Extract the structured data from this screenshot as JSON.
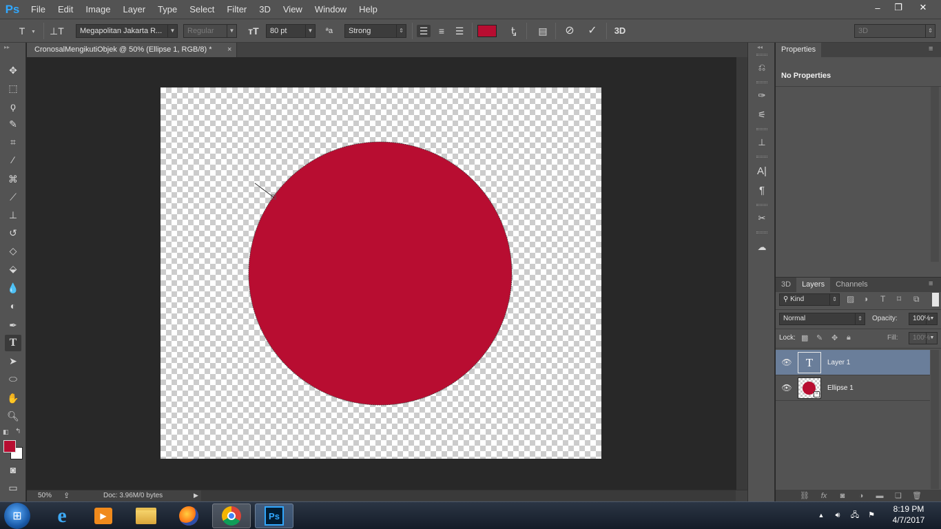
{
  "app": {
    "logo": "Ps"
  },
  "menu": [
    "File",
    "Edit",
    "Image",
    "Layer",
    "Type",
    "Select",
    "Filter",
    "3D",
    "View",
    "Window",
    "Help"
  ],
  "window_controls": {
    "minimize": "‒",
    "restore": "❐",
    "close": "✕"
  },
  "options": {
    "font_family": "Megapolitan Jakarta R...",
    "font_style": "Regular",
    "font_size": "80 pt",
    "aa_label": "ªa",
    "anti_alias": "Strong",
    "text_color": "#b80d31",
    "workspace": "3D"
  },
  "document": {
    "tab_title": "CronosalMengikutiObjek @ 50% (Ellipse 1, RGB/8) *",
    "close": "×",
    "zoom": "50%",
    "doc_info": "Doc: 3.96M/0 bytes",
    "ellipse_color": "#b80d31"
  },
  "tools": {
    "foreground_color": "#b80d31",
    "background_color": "#ffffff"
  },
  "properties": {
    "tab": "Properties",
    "body": "No Properties"
  },
  "layers": {
    "tabs": [
      "3D",
      "Layers",
      "Channels"
    ],
    "filter_kind": "Kind",
    "blend_mode": "Normal",
    "opacity_label": "Opacity:",
    "opacity": "100%",
    "lock_label": "Lock:",
    "fill_label": "Fill:",
    "fill": "100%",
    "items": [
      {
        "name": "Layer 1",
        "type": "text",
        "selected": true
      },
      {
        "name": "Ellipse 1",
        "type": "shape",
        "selected": false
      }
    ]
  },
  "taskbar": {
    "time": "8:19 PM",
    "date": "4/7/2017"
  }
}
